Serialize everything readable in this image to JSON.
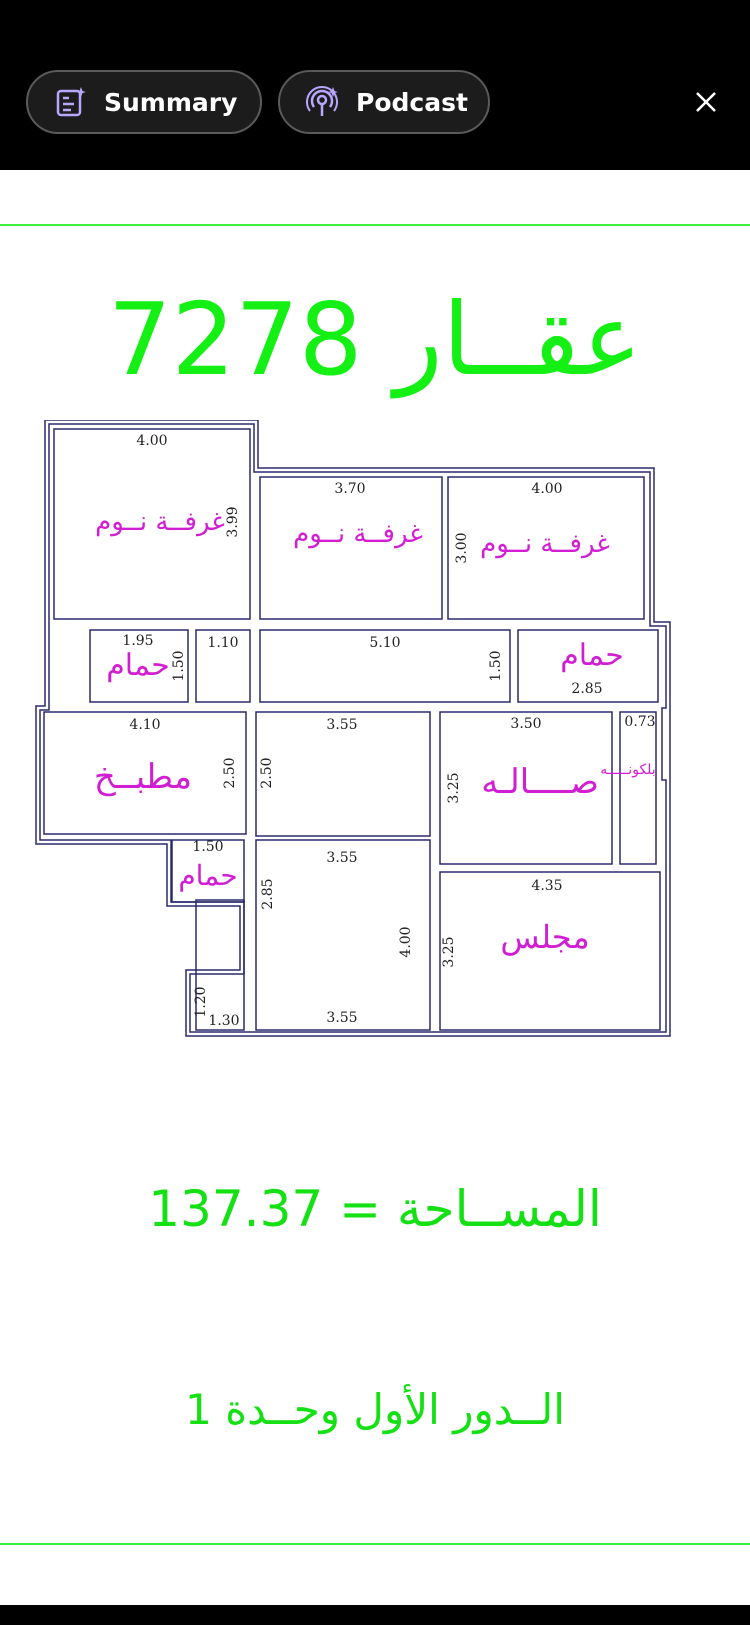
{
  "toolbar": {
    "summary_label": "Summary",
    "podcast_label": "Podcast"
  },
  "document": {
    "title": "عقــار 7278",
    "area": "المســاحة = 137.37",
    "floor": "الــدور الأول وحــدة 1"
  },
  "plan": {
    "rooms": {
      "bedroom1": "غرفــة نــوم",
      "bedroom2": "غرفــة نــوم",
      "bedroom3": "غرفــة نــوم",
      "bath1": "حمام",
      "bath2": "حمام",
      "bath3": "حمام",
      "kitchen": "مطبــخ",
      "hall": "صــــالـه",
      "majlis": "مجلس",
      "balcony": "بلكونـــــه"
    },
    "dims": {
      "d1": "4.00",
      "d2": "3.99",
      "d3": "3.70",
      "d4": "4.00",
      "d5": "3.00",
      "d6": "1.95",
      "d7": "1.50",
      "d8": "1.10",
      "d9": "5.10",
      "d10": "1.50",
      "d11": "2.85",
      "d12": "4.10",
      "d13": "2.50",
      "d14": "2.50",
      "d15": "3.55",
      "d16": "3.50",
      "d17": "3.25",
      "d18": "0.73",
      "d19": "1.50",
      "d20": "3.55",
      "d21": "2.85",
      "d22": "4.00",
      "d23": "4.35",
      "d24": "3.25",
      "d25": "1.20",
      "d26": "1.30",
      "d27": "3.55"
    }
  },
  "colors": {
    "title_green": "#14f014",
    "label_magenta": "#d21ed2",
    "wall_navy": "#2a2a6e"
  },
  "icons": [
    "summary-icon",
    "podcast-icon",
    "close-icon"
  ]
}
